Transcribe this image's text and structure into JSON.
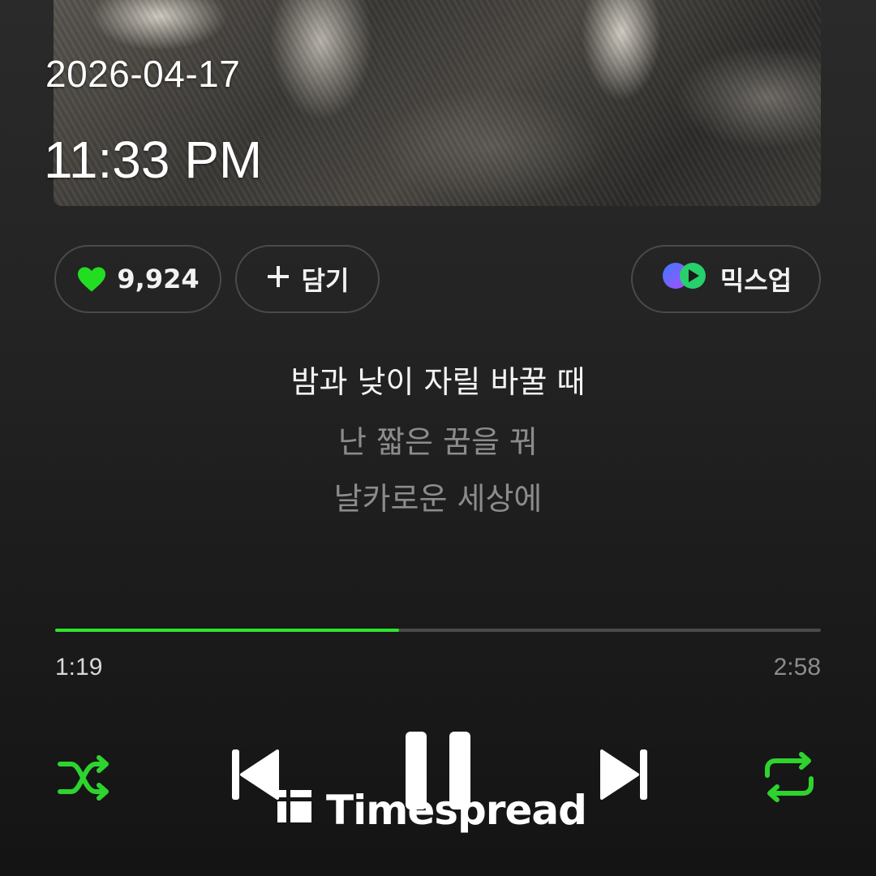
{
  "overlay": {
    "date": "2026-04-17",
    "time": "11:33 PM"
  },
  "actions": {
    "like_count": "9,924",
    "add_label": "담기",
    "mix_label": "믹스업"
  },
  "lyrics": {
    "current": "밤과 낮이 자릴 바꿀 때",
    "next": [
      "난 짧은 꿈을 꿔",
      "날카로운 세상에"
    ]
  },
  "playback": {
    "elapsed": "1:19",
    "total": "2:58",
    "progress_fraction": 0.449,
    "state": "playing"
  },
  "controls": {
    "shuffle_icon": "shuffle-icon",
    "prev_icon": "skip-previous-icon",
    "pause_icon": "pause-icon",
    "next_icon": "skip-next-icon",
    "repeat_icon": "repeat-icon"
  },
  "colors": {
    "accent": "#2ee62e",
    "heart": "#22dd22"
  },
  "watermark": {
    "text": "Timespread"
  }
}
